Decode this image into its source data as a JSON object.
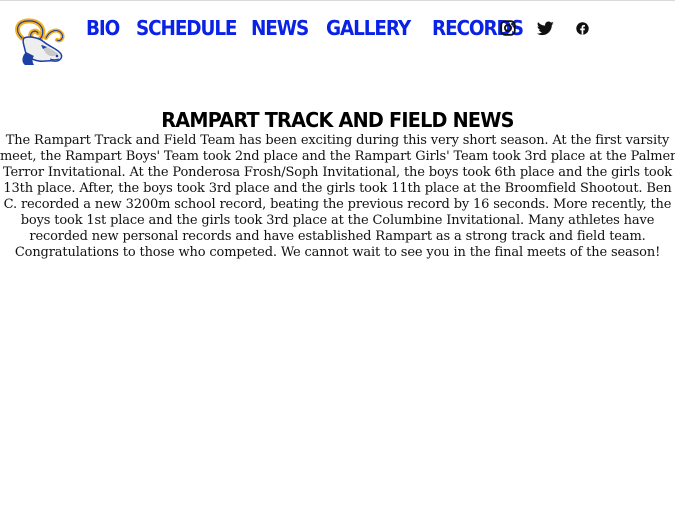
{
  "nav": {
    "items": [
      {
        "label": "BIO"
      },
      {
        "label": "SCHEDULE"
      },
      {
        "label": "NEWS"
      },
      {
        "label": "GALLERY"
      },
      {
        "label": "RECORDS"
      }
    ]
  },
  "social": {
    "icons": [
      "instagram-icon",
      "twitter-icon",
      "facebook-icon"
    ]
  },
  "colors": {
    "nav_link": "#0a22e6",
    "logo_gold": "#f2b01e",
    "logo_blue": "#1d3fa8"
  },
  "news": {
    "title": "RAMPART TRACK AND FIELD NEWS",
    "lines": [
      "The Rampart Track and Field Team has been exciting during this very short season. At the first varsity",
      "meet, the Rampart Boys' Team took 2nd place and the Rampart Girls' Team took 3rd place at the Palmer",
      "Terror Invitational. At the Ponderosa Frosh/Soph Invitational, the boys took 6th place and the girls took",
      "13th place. After, the boys took 3rd place and the girls took 11th place at the Broomfield Shootout. Ben",
      "C. recorded a new 3200m school record, beating the previous record by 16 seconds. More recently, the",
      "boys took 1st place and the girls took 3rd place at the Columbine Invitational. Many athletes have",
      "recorded new personal records and have established Rampart as a strong track and field team.",
      "Congratulations to those who competed. We cannot wait to see you in the final meets of the season!"
    ]
  }
}
